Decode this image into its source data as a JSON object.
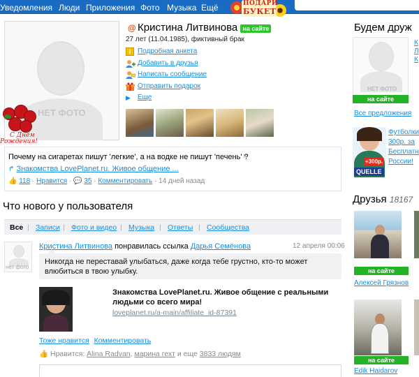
{
  "topbar": {
    "nav": [
      "Уведомления",
      "Люди",
      "Приложения",
      "Фото",
      "Музыка",
      "Ещё"
    ],
    "gift_banner": [
      "ПОДАРИ",
      "БУКЕТ"
    ]
  },
  "profile": {
    "avatar_label": "НЕТ ФОТО",
    "birthday_label": [
      "С Днём",
      "Рождения!"
    ],
    "name": "Кристина Литвинова",
    "online_badge": "на сайте",
    "info": "27 лет (11.04.1985), фиктивный брак",
    "actions": [
      "Подробная анкета",
      "Добавить в друзья",
      "Написать сообщение",
      "Отправить подарок",
      "Еще"
    ]
  },
  "status": {
    "text": "Почему на сигаретах пишут 'легкие', а на водке не пишут 'печень' ?",
    "link": "Знакомства LovePlanet.ru. Живое общение ...",
    "likes": "118",
    "like_label": "Нравится",
    "comments": "35",
    "comment_label": "Комментировать",
    "time": "14 дней назад"
  },
  "feed": {
    "title": "Что нового у пользователя",
    "tabs": [
      "Все",
      "Записи",
      "Фото и видео",
      "Музыка",
      "Ответы",
      "Сообщества"
    ],
    "avatar_label": "нет фото",
    "author": "Кристина Литвинова",
    "verb": "понравилась ссылка",
    "target": "Дарья Семёнова",
    "date": "12 апреля 00:06",
    "quote": "Никогда не переставай улыбаться, даже когда тебе грустно, кто-то может влюбиться в твою улыбку.",
    "link_title": "Знакомства LovePlanet.ru. Живое общение с реальными людьми со всего мира!",
    "link_url": "loveplanet.ru/a-main/affiliate_id-87391",
    "also_like": "Тоже нравится",
    "comment": "Комментировать",
    "likes_prefix": "Нравится:",
    "likers": [
      "Alina Radvan",
      "марина гехт"
    ],
    "likes_suffix_pre": "и еще",
    "likes_count": "3833 людям"
  },
  "sidebar": {
    "suggest_title": "Будем друж",
    "suggest_photo_label": "НЕТ ФОТО",
    "suggest_online": "на сайте",
    "suggest_links": [
      "К",
      "Л",
      "К"
    ],
    "suggest_more": "Все предложения",
    "ad_badge": "+300р.",
    "ad_brand": "QUELLE",
    "ad_lines": [
      "Футболки",
      "300р. за",
      "Бесплатн",
      "России!"
    ],
    "friends_title": "Друзья",
    "friends_count": "18167",
    "friends": [
      {
        "name": "Алексей Грязнов",
        "status": "на сайте"
      },
      {
        "name": "Edik Haidarov",
        "status": "на сайте"
      }
    ]
  }
}
